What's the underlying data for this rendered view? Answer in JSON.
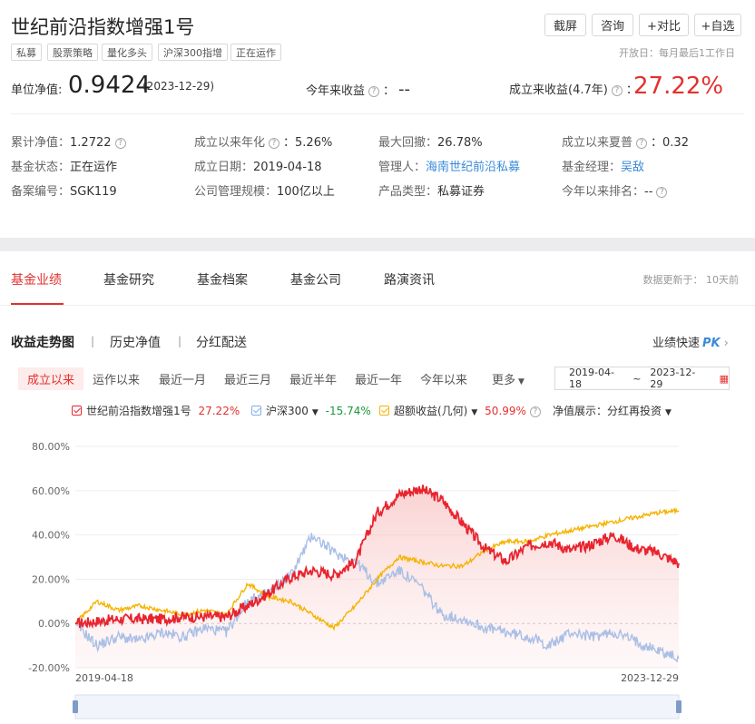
{
  "header": {
    "title": "世纪前沿指数增强1号",
    "buttons": [
      "截屏",
      "咨询",
      "+对比",
      "+自选"
    ],
    "tags": [
      "私募",
      "股票策略",
      "量化多头",
      "沪深300指增",
      "正在运作"
    ],
    "open_day": "开放日：每月最后1工作日"
  },
  "summary": {
    "nav_label": "单位净值:",
    "nav_value": "0.9424",
    "nav_date": "(2023-12-29)",
    "ytd_label": "今年来收益",
    "ytd_value": "--",
    "since_label": "成立来收益(4.7年)",
    "since_value": "27.22%"
  },
  "info": {
    "cum_nav_label": "累计净值：",
    "cum_nav_value": "1.2722",
    "annual_label": "成立以来年化",
    "annual_value": "5.26%",
    "drawdown_label": "最大回撤：",
    "drawdown_value": "26.78%",
    "sharpe_label": "成立以来夏普",
    "sharpe_value": "0.32",
    "status_label": "基金状态：",
    "status_value": "正在运作",
    "setup_label": "成立日期：",
    "setup_value": "2019-04-18",
    "manager_label": "管理人：",
    "manager_value": "海南世纪前沿私募",
    "fm_label": "基金经理：",
    "fm_value": "吴敌",
    "reg_label": "备案编号：",
    "reg_value": "SGK119",
    "scale_label": "公司管理规模：",
    "scale_value": "100亿以上",
    "type_label": "产品类型：",
    "type_value": "私募证券",
    "rank_label": "今年以来排名：",
    "rank_value": "--"
  },
  "tabs": [
    "基金业绩",
    "基金研究",
    "基金档案",
    "基金公司",
    "路演资讯"
  ],
  "data_update": "数据更新于： 10天前",
  "subtabs": [
    "收益走势图",
    "历史净值",
    "分红配送"
  ],
  "pk_label": "业绩快速",
  "pk_badge": "PK",
  "ranges": [
    "成立以来",
    "运作以来",
    "最近一月",
    "最近三月",
    "最近半年",
    "最近一年",
    "今年以来",
    "更多"
  ],
  "date_start": "2019-04-18",
  "date_sep": "~",
  "date_end": "2023-12-29",
  "legend": {
    "fund_name": "世纪前沿指数增强1号",
    "fund_value": "27.22%",
    "bench_name": "沪深300",
    "bench_value": "-15.74%",
    "excess_name": "超额收益(几何)",
    "excess_value": "50.99%",
    "nav_show_label": "净值展示：",
    "nav_show_value": "分红再投资"
  },
  "colors": {
    "fund": "#e8242f",
    "bench": "#a9bfe6",
    "excess": "#f5b301",
    "accent": "#e2312e"
  },
  "chart_data": {
    "type": "line",
    "ylim": [
      -20,
      80
    ],
    "y_ticks": [
      "80.00%",
      "60.00%",
      "40.00%",
      "20.00%",
      "0.00%",
      "-20.00%"
    ],
    "x_tick_labels": [
      "2019-04-18",
      "2023-12-29"
    ],
    "x": [
      "2019-04",
      "2019-06",
      "2019-08",
      "2019-10",
      "2019-12",
      "2020-02",
      "2020-04",
      "2020-06",
      "2020-08",
      "2020-10",
      "2020-12",
      "2021-02",
      "2021-04",
      "2021-06",
      "2021-08",
      "2021-10",
      "2021-12",
      "2022-02",
      "2022-04",
      "2022-06",
      "2022-08",
      "2022-10",
      "2022-12",
      "2023-02",
      "2023-04",
      "2023-06",
      "2023-08",
      "2023-10",
      "2023-12"
    ],
    "series": [
      {
        "name": "世纪前沿指数增强1号",
        "values": [
          0,
          1,
          2,
          2,
          2,
          3,
          3,
          3,
          8,
          14,
          21,
          24,
          22,
          28,
          50,
          58,
          61,
          56,
          45,
          34,
          28,
          35,
          37,
          33,
          36,
          40,
          34,
          32,
          27.22
        ]
      },
      {
        "name": "沪深300",
        "values": [
          0,
          -10,
          -6,
          -8,
          -4,
          -6,
          -2,
          -4,
          10,
          14,
          22,
          40,
          32,
          28,
          18,
          24,
          17,
          4,
          2,
          -2,
          -4,
          -6,
          -10,
          -4,
          -6,
          -4,
          -8,
          -12,
          -15.74
        ]
      },
      {
        "name": "超额收益(几何)",
        "values": [
          0,
          10,
          6,
          8,
          6,
          4,
          6,
          4,
          18,
          12,
          10,
          4,
          -2,
          8,
          20,
          30,
          28,
          26,
          26,
          33,
          37,
          37,
          40,
          42,
          44,
          46,
          48,
          50,
          50.99
        ]
      }
    ]
  }
}
